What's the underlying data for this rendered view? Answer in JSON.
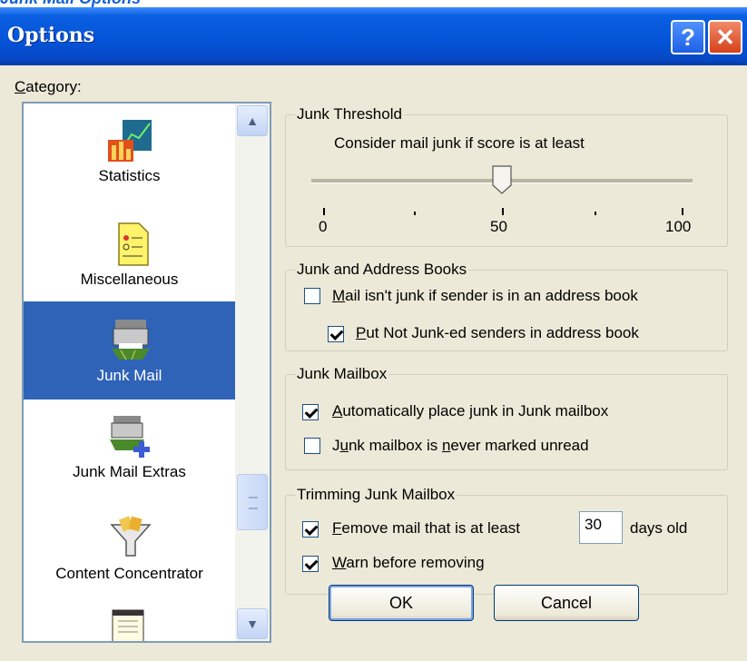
{
  "header_strip": {
    "text": "Junk Mail Options"
  },
  "window": {
    "title": "Options",
    "help_label": "?",
    "close_label": "✕"
  },
  "category": {
    "label_accel": "C",
    "label_rest": "ategory:",
    "items": [
      {
        "label": "Statistics",
        "icon": "statistics-chart-icon"
      },
      {
        "label": "Miscellaneous",
        "icon": "miscellaneous-form-icon"
      },
      {
        "label": "Junk Mail",
        "icon": "junk-mail-icon",
        "selected": true
      },
      {
        "label": "Junk Mail Extras",
        "icon": "junk-mail-extras-icon"
      },
      {
        "label": "Content Concentrator",
        "icon": "content-concentrator-funnel-icon"
      }
    ]
  },
  "threshold": {
    "title": "Junk Threshold",
    "prompt": "Consider mail junk if score is at least",
    "value": 50,
    "min_label": "0",
    "mid_label": "50",
    "max_label": "100"
  },
  "address_books": {
    "title": "Junk and Address Books",
    "opt1": {
      "accel": "M",
      "rest": "ail isn't junk if sender is in an address book",
      "checked": false
    },
    "opt2": {
      "accel": "P",
      "rest": "ut Not Junk-ed senders in address book",
      "checked": true
    }
  },
  "mailbox": {
    "title": "Junk Mailbox",
    "opt1": {
      "accel": "A",
      "rest": "utomatically place junk in Junk mailbox",
      "checked": true
    },
    "opt2": {
      "pre": "J",
      "accel": "u",
      "mid": "nk mailbox is ",
      "accel2": "n",
      "rest": "ever marked unread",
      "checked": false
    }
  },
  "trimming": {
    "title": "Trimming Junk Mailbox",
    "opt1": {
      "accel": "F",
      "rest": "emove mail that is at least",
      "checked": true,
      "days": "30",
      "suffix": "days old"
    },
    "opt2": {
      "accel": "W",
      "rest": "arn before removing",
      "checked": true
    }
  },
  "buttons": {
    "ok": "OK",
    "cancel": "Cancel"
  }
}
